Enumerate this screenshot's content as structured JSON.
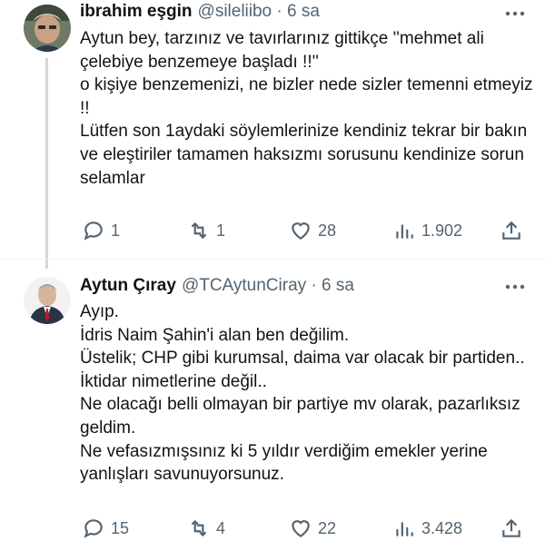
{
  "tweets": [
    {
      "name": "ibrahim eşgin",
      "handle": "@sileliibo · 6 sa",
      "text": "Aytun bey, tarzınız ve tavırlarınız gittikçe ''mehmet ali çelebiye benzemeye başladı !!''\no kişiye benzemenizi, ne bizler nede sizler temenni etmeyiz !!\nLütfen son 1aydaki söylemlerinize kendiniz tekrar bir bakın ve eleştiriler tamamen haksızmı sorusunu kendinize sorun\nselamlar",
      "replies": "1",
      "retweets": "1",
      "likes": "28",
      "views": "1.902",
      "icons": {
        "reply": "reply-icon",
        "retweet": "retweet-icon",
        "like": "heart-icon",
        "views": "views-icon",
        "share": "share-icon"
      }
    },
    {
      "name": "Aytun Çıray",
      "handle": "@TCAytunCiray · 6 sa",
      "text": "Ayıp.\nİdris Naim Şahin'i alan ben değilim.\nÜstelik; CHP gibi kurumsal, daima var olacak bir partiden..\nİktidar nimetlerine değil..\nNe olacağı belli olmayan bir partiye mv olarak, pazarlıksız geldim.\nNe vefasızmışsınız ki 5 yıldır verdiğim emekler yerine yanlışları savunuyorsunuz.",
      "replies": "15",
      "retweets": "4",
      "likes": "22",
      "views": "3.428"
    }
  ],
  "colors": {
    "text": "#0f1419",
    "secondary": "#536471",
    "line": "#cfd9de"
  }
}
